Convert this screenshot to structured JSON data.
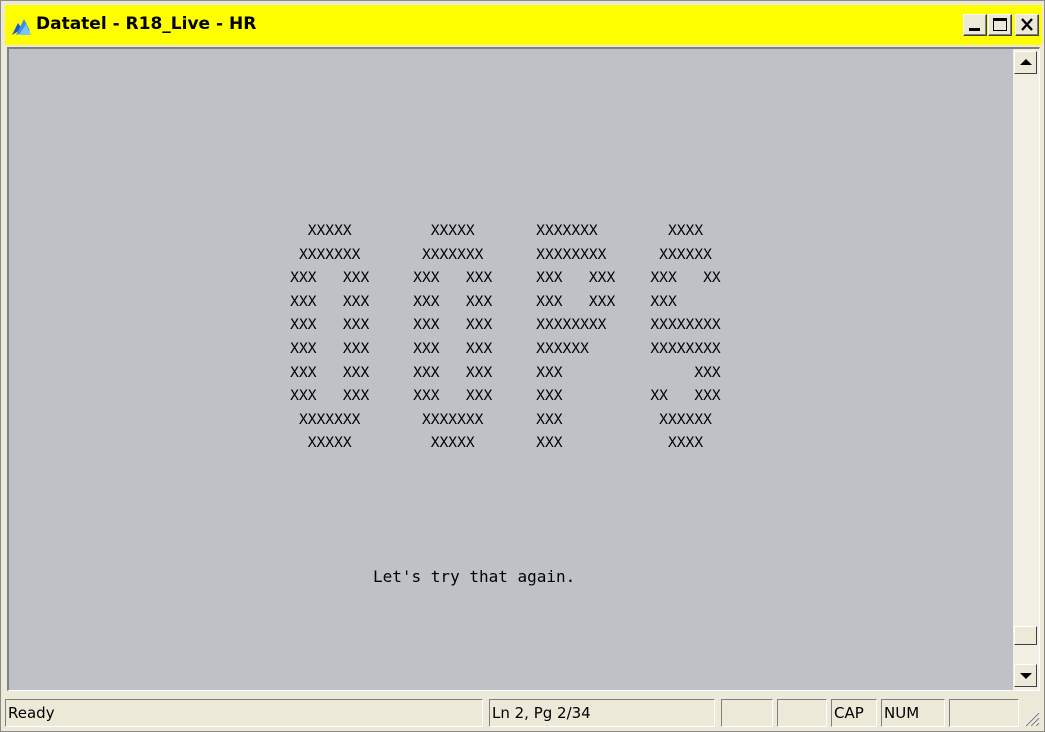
{
  "window": {
    "title": "Datatel - R18_Live - HR",
    "title_bar_color": "#ffff00",
    "app_icon": "datatel-app-icon",
    "controls": {
      "minimize_icon": "minimize-icon",
      "maximize_icon": "maximize-icon",
      "close_icon": "close-icon"
    }
  },
  "terminal": {
    "background": "#bec2c6",
    "ascii_art": [
      "                                  XXXXX         XXXXX       XXXXXXX        XXXX",
      "                                 XXXXXXX       XXXXXXX      XXXXXXXX      XXXXXX",
      "                                XXX   XXX     XXX   XXX     XXX   XXX    XXX   XX",
      "                                XXX   XXX     XXX   XXX     XXX   XXX    XXX",
      "                                XXX   XXX     XXX   XXX     XXXXXXXX     XXXXXXXX",
      "                                XXX   XXX     XXX   XXX     XXXXXX       XXXXXXXX",
      "                                XXX   XXX     XXX   XXX     XXX               XXX",
      "                                XXX   XXX     XXX   XXX     XXX          XX   XXX",
      "                                 XXXXXXX       XXXXXXX      XXX           XXXXXX",
      "                                  XXXXX         XXXXX       XXX            XXXX"
    ],
    "message": "Let's try that again."
  },
  "scrollbar": {
    "up_icon": "scroll-up-arrow-icon",
    "down_icon": "scroll-down-arrow-icon"
  },
  "statusbar": {
    "status": "Ready",
    "position": "Ln 2, Pg 2/34",
    "empty1": "",
    "empty2": "",
    "caps": "CAP",
    "num": "NUM",
    "empty3": ""
  }
}
